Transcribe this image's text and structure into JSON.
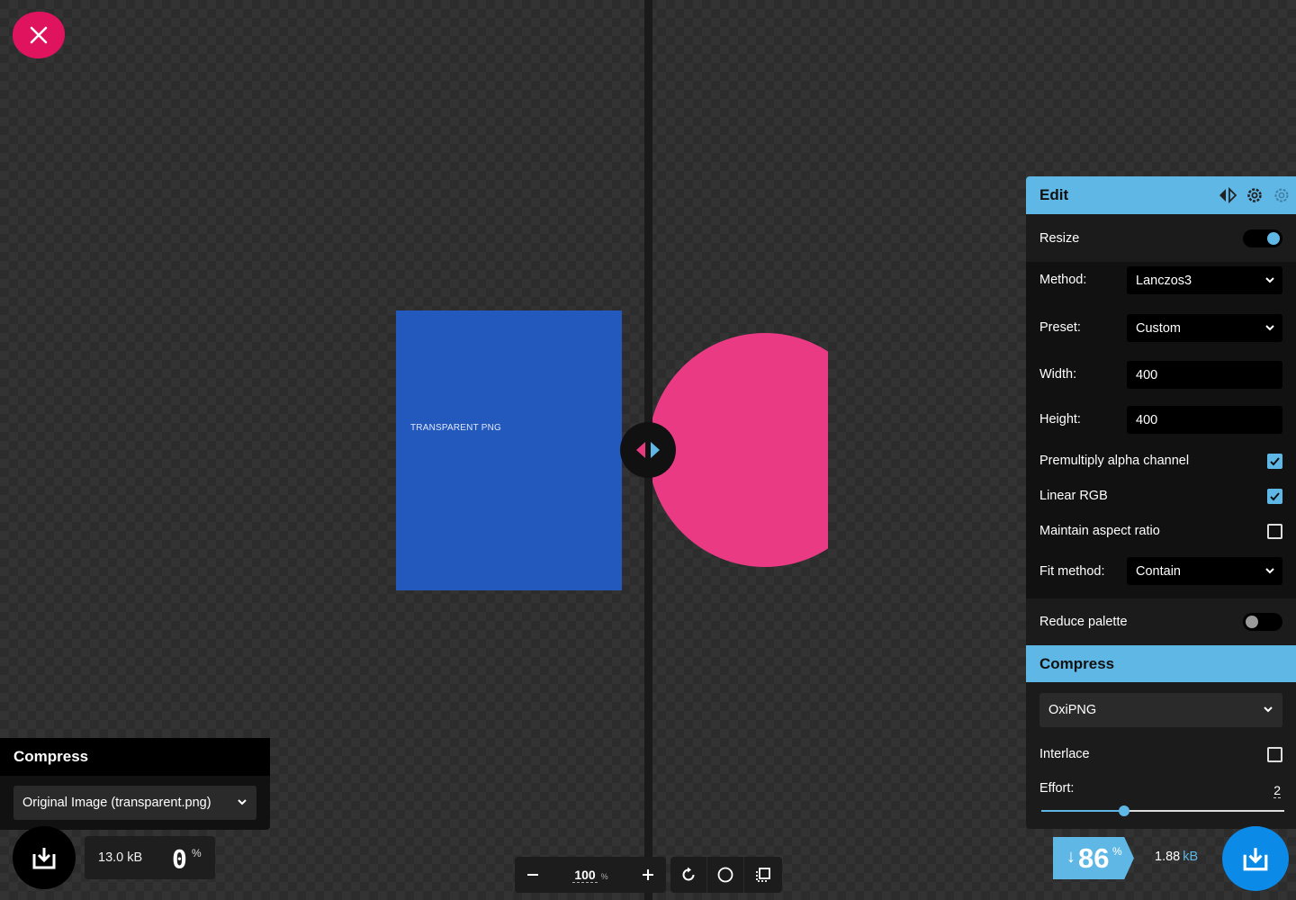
{
  "canvas": {
    "left_image_label": "TRANSPARENT PNG"
  },
  "left_panel": {
    "title": "Compress",
    "select_value": "Original Image (transparent.png)",
    "size": "13.0 kB",
    "percent": "0",
    "percent_sign": "%"
  },
  "zoom": {
    "value": "100",
    "unit": "%"
  },
  "right_panel": {
    "edit_title": "Edit",
    "resize_label": "Resize",
    "resize_on": true,
    "method_label": "Method:",
    "method_value": "Lanczos3",
    "preset_label": "Preset:",
    "preset_value": "Custom",
    "width_label": "Width:",
    "width_value": "400",
    "height_label": "Height:",
    "height_value": "400",
    "premultiply_label": "Premultiply alpha channel",
    "premultiply_checked": true,
    "linear_rgb_label": "Linear RGB",
    "linear_rgb_checked": true,
    "aspect_label": "Maintain aspect ratio",
    "aspect_checked": false,
    "fit_label": "Fit method:",
    "fit_value": "Contain",
    "reduce_palette_label": "Reduce palette",
    "reduce_palette_on": false,
    "compress_title": "Compress",
    "codec_value": "OxiPNG",
    "interlace_label": "Interlace",
    "interlace_checked": false,
    "effort_label": "Effort:",
    "effort_value": "2",
    "effort_fraction": 0.34
  },
  "result": {
    "arrow": "↓",
    "savings": "86",
    "savings_sign": "%",
    "size_value": "1.88",
    "size_unit": "kB"
  },
  "colors": {
    "accent": "#5fb7e5",
    "close": "#e0135f",
    "blue_image": "#2359bc",
    "pink_image": "#ea3a83",
    "download": "#0b8ae8"
  },
  "icons": [
    "close-icon",
    "split-arrows-icon",
    "download-icon",
    "zoom-out-icon",
    "zoom-in-icon",
    "rotate-icon",
    "background-toggle-icon",
    "crop-icon",
    "view-toggle-icon",
    "settings-icon",
    "chevron-down-icon",
    "check-icon"
  ]
}
